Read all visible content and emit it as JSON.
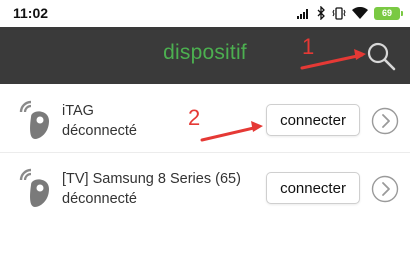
{
  "status_bar": {
    "time": "11:02",
    "battery_level": "69",
    "icons": [
      "signal-icon",
      "bluetooth-icon",
      "vibrate-icon",
      "wifi-icon",
      "battery-icon"
    ]
  },
  "app_bar": {
    "title": "dispositif",
    "title_color": "#4caf50",
    "background": "#3a3a3a",
    "search_icon": "search-icon"
  },
  "devices": [
    {
      "name": "iTAG",
      "status": "déconnecté",
      "connect_label": "connecter",
      "icon": "itag-device-icon"
    },
    {
      "name": "[TV] Samsung 8 Series (65)",
      "status": "déconnecté",
      "connect_label": "connecter",
      "icon": "itag-device-icon"
    }
  ],
  "annotations": [
    {
      "label": "1",
      "color": "#e53935",
      "points_to": "search-button"
    },
    {
      "label": "2",
      "color": "#e53935",
      "points_to": "connect-button"
    }
  ]
}
